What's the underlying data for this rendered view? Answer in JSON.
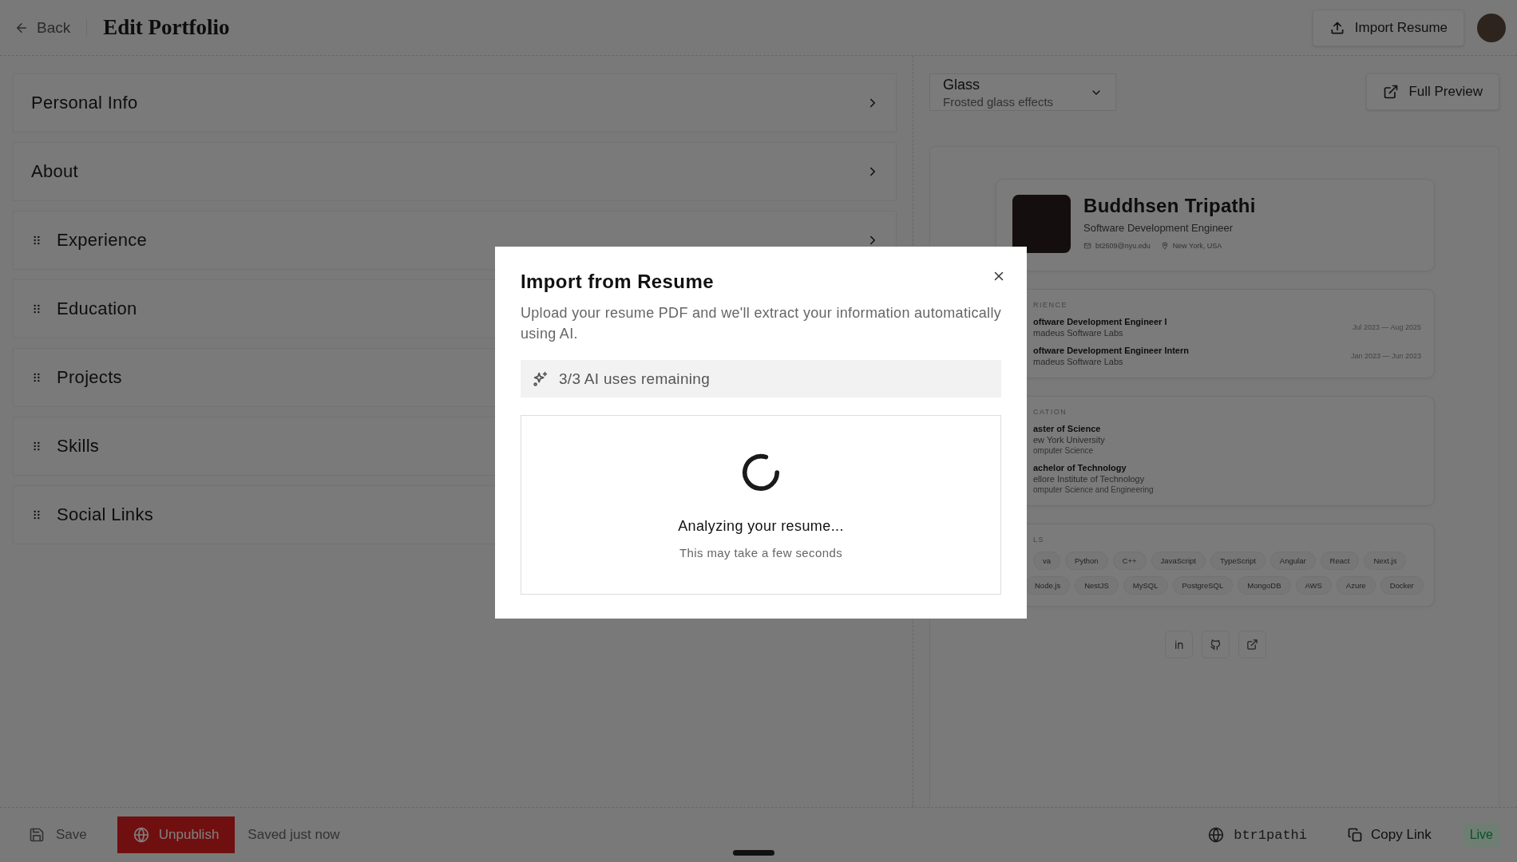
{
  "header": {
    "back": "Back",
    "title": "Edit Portfolio",
    "import_button": "Import Resume"
  },
  "sections": [
    {
      "label": "Personal Info",
      "kind": "fixed"
    },
    {
      "label": "About",
      "kind": "fixed"
    },
    {
      "label": "Experience",
      "kind": "draggable"
    },
    {
      "label": "Education",
      "kind": "draggable"
    },
    {
      "label": "Projects",
      "kind": "draggable"
    },
    {
      "label": "Skills",
      "kind": "draggable"
    },
    {
      "label": "Social Links",
      "kind": "draggable"
    }
  ],
  "theme_select": {
    "value": "Glass",
    "description": "Frosted glass effects"
  },
  "full_preview": "Full Preview",
  "preview": {
    "name": "Buddhsen Tripathi",
    "role": "Software Development Engineer",
    "email": "bt2609@nyu.edu",
    "location": "New York, USA",
    "experience": {
      "heading": "RIENCE",
      "items": [
        {
          "title": "oftware Development Engineer I",
          "company": "madeus Software Labs",
          "dates": "Jul 2023 — Aug 2025"
        },
        {
          "title": "oftware Development Engineer Intern",
          "company": "madeus Software Labs",
          "dates": "Jan 2023 — Jun 2023"
        }
      ]
    },
    "education": {
      "heading": "CATION",
      "items": [
        {
          "degree": "aster of Science",
          "school": "ew York University",
          "field": "omputer Science"
        },
        {
          "degree": "achelor of Technology",
          "school": "ellore Institute of Technology",
          "field": "omputer Science and Engineering"
        }
      ]
    },
    "skills": {
      "heading": "LS",
      "tags": [
        [
          "va",
          "Python",
          "C++",
          "JavaScript",
          "TypeScript",
          "Angular",
          "React",
          "Next.js"
        ],
        [
          "Node.js",
          "NestJS",
          "MySQL",
          "PostgreSQL",
          "MongoDB",
          "AWS",
          "Azure",
          "Docker"
        ]
      ]
    }
  },
  "modal": {
    "title": "Import from Resume",
    "description": "Upload your resume PDF and we'll extract your information automatically using AI.",
    "ai_uses": "3/3 AI uses remaining",
    "status": "Analyzing your resume...",
    "hint": "This may take a few seconds"
  },
  "footer": {
    "save": "Save",
    "unpublish": "Unpublish",
    "status": "Saved just now",
    "username": "btr1pathi",
    "copy_link": "Copy Link",
    "badge": "Live"
  }
}
